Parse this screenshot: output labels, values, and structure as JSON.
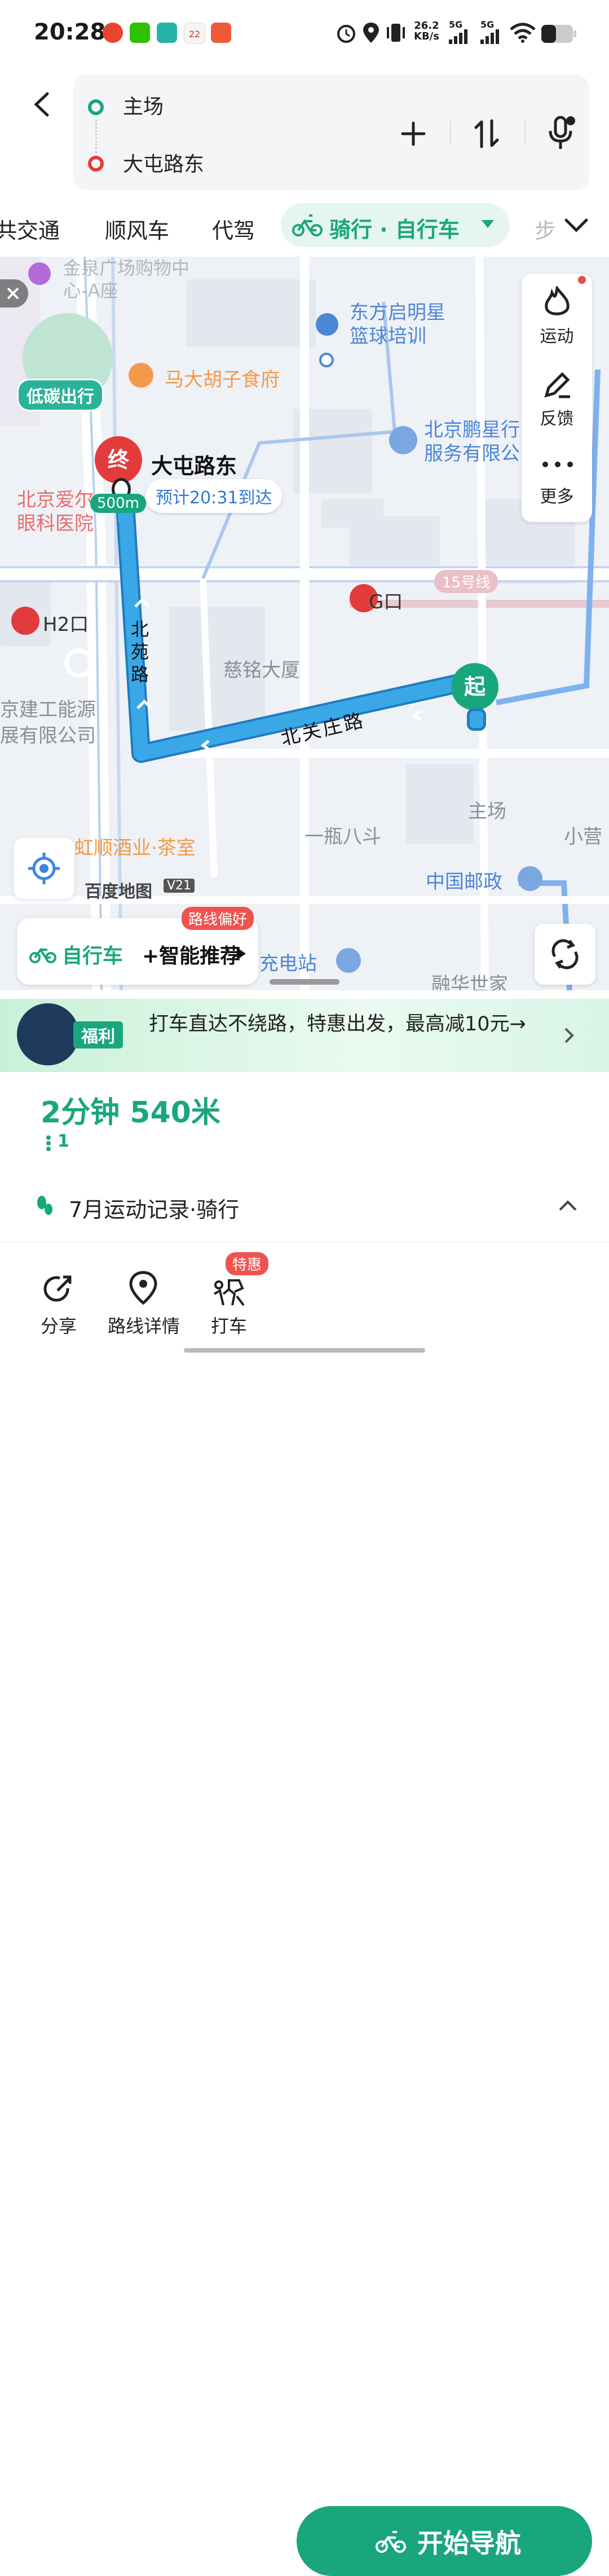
{
  "status_bar": {
    "time": "20:28",
    "net_speed_value": "26.2",
    "net_speed_unit": "KB/s",
    "network_1": "5G",
    "network_2": "5G",
    "notif_badge": "22"
  },
  "route": {
    "origin": "主场",
    "destination": "大屯路东"
  },
  "tabs": [
    {
      "label": "共交通"
    },
    {
      "label": "顺风车"
    },
    {
      "label": "代驾"
    },
    {
      "label": "骑行 · 自行车"
    },
    {
      "label": "步"
    }
  ],
  "map": {
    "low_carbon_badge": "低碳出行",
    "end_marker": "终",
    "start_marker": "起",
    "destination_name": "大屯路东",
    "eta": "预计20:31到达",
    "distance_tag": "500m",
    "road_beiyuan": "北苑路",
    "road_beiguanzhuang": "北关庄路",
    "line_15": "15号线",
    "poi_jinquan": "金泉广场购物中心-A座",
    "poi_dongfang": "东方启明星篮球培训",
    "poi_madahu": "马大胡子食府",
    "poi_pengxing": "北京鹏星行服务有限公",
    "poi_aier": "北京爱尔眼科医院",
    "poi_g_exit": "G口",
    "poi_h2_exit": "H2口",
    "poi_ciming": "慈铭大厦",
    "poi_jiangong": "京建工能源展有限公司",
    "poi_zhuchang": "主场",
    "poi_yiping": "一瓶八斗",
    "poi_xiaoying": "小营",
    "poi_hongshun": "虹顺酒业·茶室",
    "poi_post": "中国邮政",
    "poi_charge": "充电站",
    "poi_ronghua": "融华世家",
    "map_logo": "百度地图",
    "map_logo_year": "V21",
    "side_sport": "运动",
    "side_feedback": "反馈",
    "side_more": "更多",
    "route_pref_badge": "路线偏好",
    "route_pref_mode": "自行车",
    "route_pref_text": "+智能推荐"
  },
  "promo": {
    "badge": "福利",
    "text": "打车直达不绕路，特惠出发，最高减10元→"
  },
  "summary": {
    "duration_distance": "2分钟 540米",
    "traffic_lights": "1",
    "activity_record": "7月运动记录·骑行"
  },
  "bottom_bar": {
    "share": "分享",
    "route_detail": "路线详情",
    "taxi": "打车",
    "taxi_badge": "特惠",
    "start_nav": "开始导航"
  },
  "colors": {
    "accent_green": "#1aa67c",
    "route_blue": "#3aa8e6",
    "end_red": "#e33b3b"
  }
}
